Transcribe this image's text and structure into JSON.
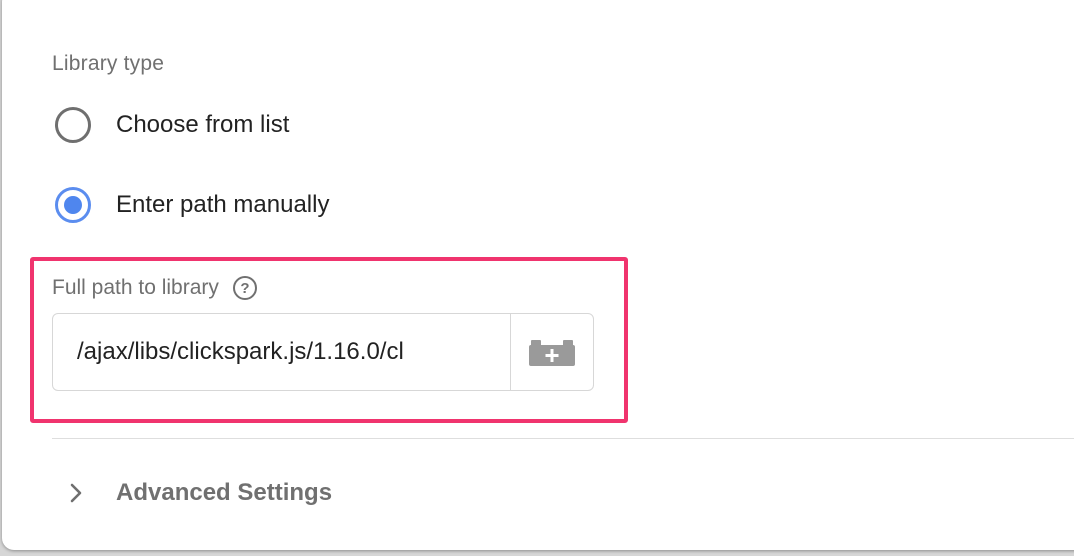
{
  "library_type": {
    "label": "Library type",
    "options": [
      {
        "label": "Choose from list",
        "checked": false
      },
      {
        "label": "Enter path manually",
        "checked": true
      }
    ]
  },
  "path_field": {
    "label": "Full path to library",
    "value": "/ajax/libs/clickspark.js/1.16.0/cl",
    "help_icon": "question-circle-icon",
    "variable_icon": "add-variable-brick-icon"
  },
  "advanced": {
    "label": "Advanced Settings",
    "icon": "chevron-right-icon"
  },
  "colors": {
    "highlight": "#f0346e",
    "radio_selected": "#4f86ee",
    "radio_unselected": "#6f6f6f",
    "label_grey": "#707070"
  }
}
